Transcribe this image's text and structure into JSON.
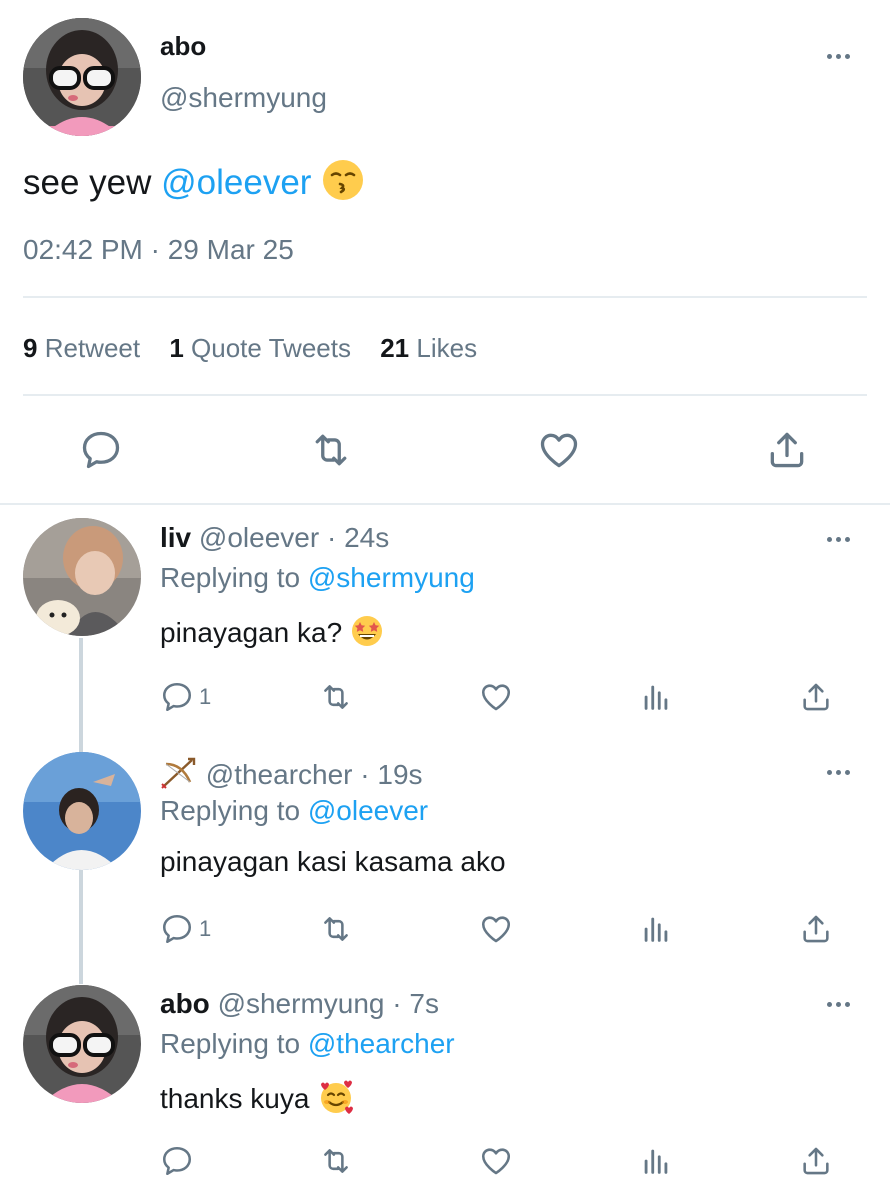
{
  "main_tweet": {
    "name": "abo",
    "handle": "@shermyung",
    "text_prefix": "see yew",
    "mention": "@oleever",
    "emoji": "kissing-face-emoji",
    "timestamp": "02:42 PM · 29 Mar 25",
    "stats": {
      "retweets_count": "9",
      "retweets_label": "Retweet",
      "quotes_count": "1",
      "quotes_label": "Quote Tweets",
      "likes_count": "21",
      "likes_label": "Likes"
    }
  },
  "replies": [
    {
      "name": "liv",
      "handle": "@oleever",
      "sep": "·",
      "time": "24s",
      "replying_label": "Replying to",
      "replying_to": "@shermyung",
      "text": "pinayagan ka?",
      "emoji": "star-struck-emoji",
      "reply_count": "1"
    },
    {
      "name_icon": "bow-and-arrow-icon",
      "handle": "@thearcher",
      "sep": "·",
      "time": "19s",
      "replying_label": "Replying to",
      "replying_to": "@oleever",
      "text": "pinayagan kasi kasama ako",
      "reply_count": "1"
    },
    {
      "name": "abo",
      "handle": "@shermyung",
      "sep": "·",
      "time": "7s",
      "replying_label": "Replying to",
      "replying_to": "@thearcher",
      "text": "thanks kuya",
      "emoji": "smiling-face-with-hearts-emoji",
      "reply_count": ""
    }
  ],
  "colors": {
    "link": "#1da1f2",
    "muted": "#657786",
    "divider": "#e6ecf0"
  }
}
